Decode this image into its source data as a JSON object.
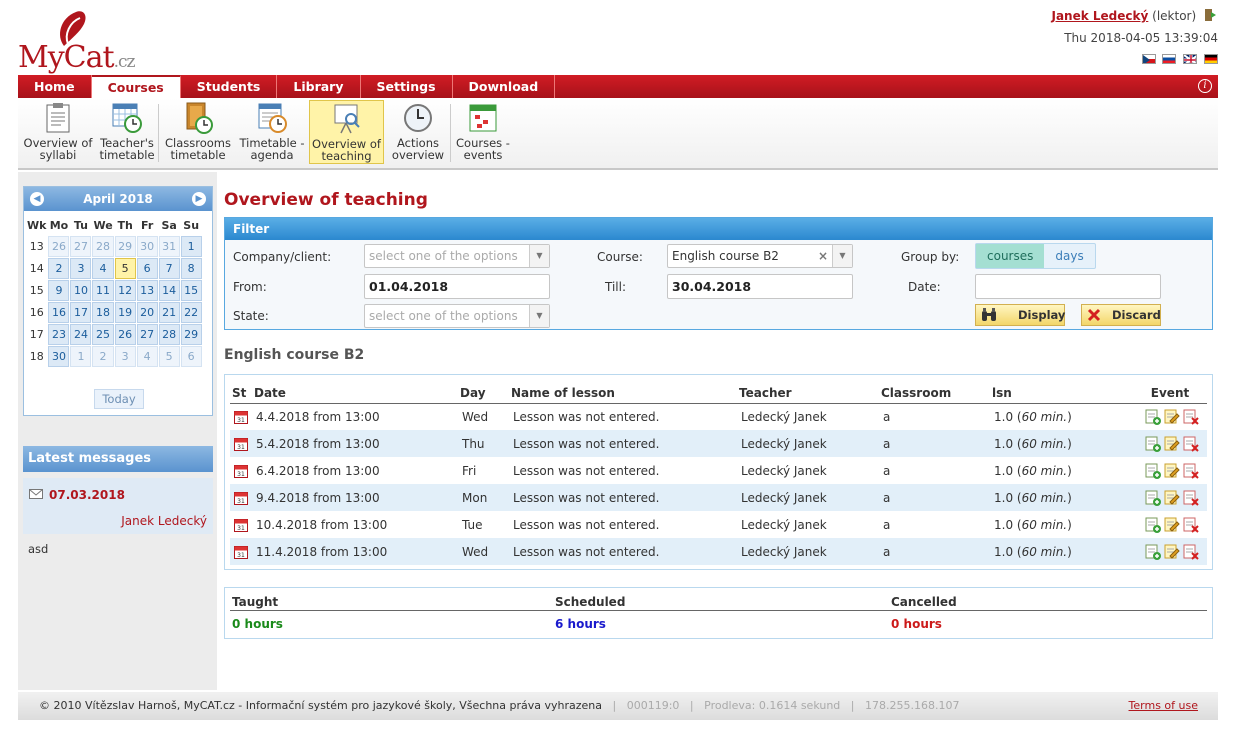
{
  "header": {
    "logo_text": "MyCat",
    "logo_suffix": ".cz",
    "user_name": "Janek Ledecký",
    "user_role": "(lektor)",
    "datetime": "Thu 2018-04-05 13:39:04",
    "flags": [
      "cz",
      "sk",
      "gb",
      "de"
    ]
  },
  "nav": {
    "items": [
      "Home",
      "Courses",
      "Students",
      "Library",
      "Settings",
      "Download"
    ],
    "active": "Courses"
  },
  "toolbar": {
    "items": [
      {
        "line1": "Overview of",
        "line2": "syllabi"
      },
      {
        "line1": "Teacher's",
        "line2": "timetable"
      },
      {
        "line1": "Classrooms",
        "line2": "timetable"
      },
      {
        "line1": "Timetable -",
        "line2": "agenda"
      },
      {
        "line1": "Overview of",
        "line2": "teaching"
      },
      {
        "line1": "Actions",
        "line2": "overview"
      },
      {
        "line1": "Courses -",
        "line2": "events"
      }
    ],
    "active_index": 4
  },
  "calendar": {
    "month": "April 2018",
    "weekday_headers": [
      "Wk",
      "Mo",
      "Tu",
      "We",
      "Th",
      "Fr",
      "Sa",
      "Su"
    ],
    "weeks": [
      {
        "wk": "13",
        "days": [
          "26",
          "27",
          "28",
          "29",
          "30",
          "31",
          "1"
        ]
      },
      {
        "wk": "14",
        "days": [
          "2",
          "3",
          "4",
          "5",
          "6",
          "7",
          "8"
        ]
      },
      {
        "wk": "15",
        "days": [
          "9",
          "10",
          "11",
          "12",
          "13",
          "14",
          "15"
        ]
      },
      {
        "wk": "16",
        "days": [
          "16",
          "17",
          "18",
          "19",
          "20",
          "21",
          "22"
        ]
      },
      {
        "wk": "17",
        "days": [
          "23",
          "24",
          "25",
          "26",
          "27",
          "28",
          "29"
        ]
      },
      {
        "wk": "18",
        "days": [
          "30",
          "1",
          "2",
          "3",
          "4",
          "5",
          "6"
        ]
      }
    ],
    "today": "5",
    "today_button": "Today"
  },
  "messages": {
    "title": "Latest messages",
    "items": [
      {
        "date": "07.03.2018",
        "author": "Janek Ledecký",
        "body": "asd"
      }
    ]
  },
  "main": {
    "title": "Overview of teaching",
    "filter": {
      "title": "Filter",
      "company_label": "Company/client:",
      "company_placeholder": "select one of the options",
      "course_label": "Course:",
      "course_value": "English course B2",
      "group_label": "Group by:",
      "group_options": [
        "courses",
        "days"
      ],
      "from_label": "From:",
      "from_value": "01.04.2018",
      "till_label": "Till:",
      "till_value": "30.04.2018",
      "date_label": "Date:",
      "date_value": "",
      "state_label": "State:",
      "state_placeholder": "select one of the options",
      "display_button": "Display",
      "discard_button": "Discard"
    },
    "course_title": "English course B2",
    "table": {
      "headers": [
        "St",
        "Date",
        "Day",
        "Name of lesson",
        "Teacher",
        "Classroom",
        "lsn",
        "Event"
      ],
      "rows": [
        {
          "date": "4.4.2018 from 13:00",
          "day": "Wed",
          "name": "Lesson was not entered.",
          "teacher": "Ledecký Janek",
          "room": "a",
          "lsn": "1.0",
          "lsn_min": "60 min."
        },
        {
          "date": "5.4.2018 from 13:00",
          "day": "Thu",
          "name": "Lesson was not entered.",
          "teacher": "Ledecký Janek",
          "room": "a",
          "lsn": "1.0",
          "lsn_min": "60 min."
        },
        {
          "date": "6.4.2018 from 13:00",
          "day": "Fri",
          "name": "Lesson was not entered.",
          "teacher": "Ledecký Janek",
          "room": "a",
          "lsn": "1.0",
          "lsn_min": "60 min."
        },
        {
          "date": "9.4.2018 from 13:00",
          "day": "Mon",
          "name": "Lesson was not entered.",
          "teacher": "Ledecký Janek",
          "room": "a",
          "lsn": "1.0",
          "lsn_min": "60 min."
        },
        {
          "date": "10.4.2018 from 13:00",
          "day": "Tue",
          "name": "Lesson was not entered.",
          "teacher": "Ledecký Janek",
          "room": "a",
          "lsn": "1.0",
          "lsn_min": "60 min."
        },
        {
          "date": "11.4.2018 from 13:00",
          "day": "Wed",
          "name": "Lesson was not entered.",
          "teacher": "Ledecký Janek",
          "room": "a",
          "lsn": "1.0",
          "lsn_min": "60 min."
        }
      ]
    },
    "summary": {
      "taught_label": "Taught",
      "taught_value": "0 hours",
      "taught_color": "#1a8a1a",
      "scheduled_label": "Scheduled",
      "scheduled_value": "6 hours",
      "scheduled_color": "#1a1acc",
      "cancelled_label": "Cancelled",
      "cancelled_value": "0 hours",
      "cancelled_color": "#cc1a1a"
    }
  },
  "footer": {
    "copyright": "© 2010 Vítězslav Harnoš, MyCAT.cz - Informační systém pro jazykové školy, Všechna práva vyhrazena",
    "code": "000119:0",
    "timing": "Prodleva: 0.1614 sekund",
    "ip": "178.255.168.107",
    "terms": "Terms of use"
  }
}
